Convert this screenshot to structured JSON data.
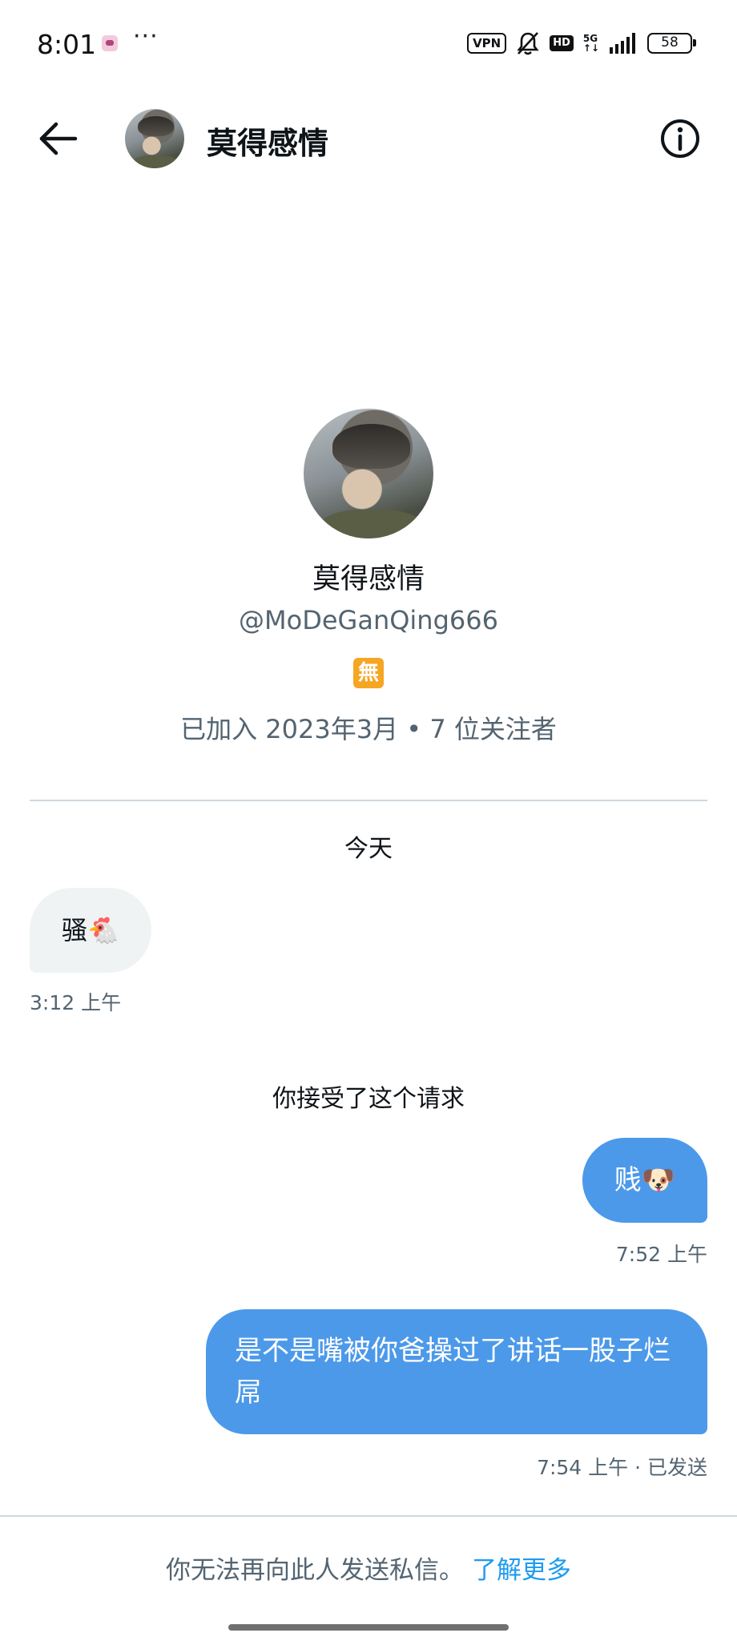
{
  "status_bar": {
    "time": "8:01",
    "dots": "···",
    "vpn": "VPN",
    "hd": "HD",
    "network_top": "5G",
    "network_bottom": "↑↓",
    "battery": "58"
  },
  "header": {
    "name": "莫得感情"
  },
  "profile": {
    "name": "莫得感情",
    "handle": "@MoDeGanQing666",
    "badge": "無",
    "meta": "已加入 2023年3月 • 7 位关注者"
  },
  "conversation": {
    "date_label": "今天",
    "messages_in": [
      {
        "text": "骚🐔",
        "time": "3:12 上午"
      }
    ],
    "system_message": "你接受了这个请求",
    "messages_out": [
      {
        "text": "贱🐶",
        "time": "7:52 上午"
      },
      {
        "text": "是不是嘴被你爸操过了讲话一股子烂屌",
        "time": "7:54 上午 · 已发送"
      }
    ]
  },
  "footer": {
    "notice": "你无法再向此人发送私信。",
    "learn_more": "了解更多"
  },
  "colors": {
    "accent": "#1d9bf0",
    "bubble_out": "#4c99e9",
    "bubble_in": "#eff3f4",
    "secondary_text": "#536471"
  }
}
